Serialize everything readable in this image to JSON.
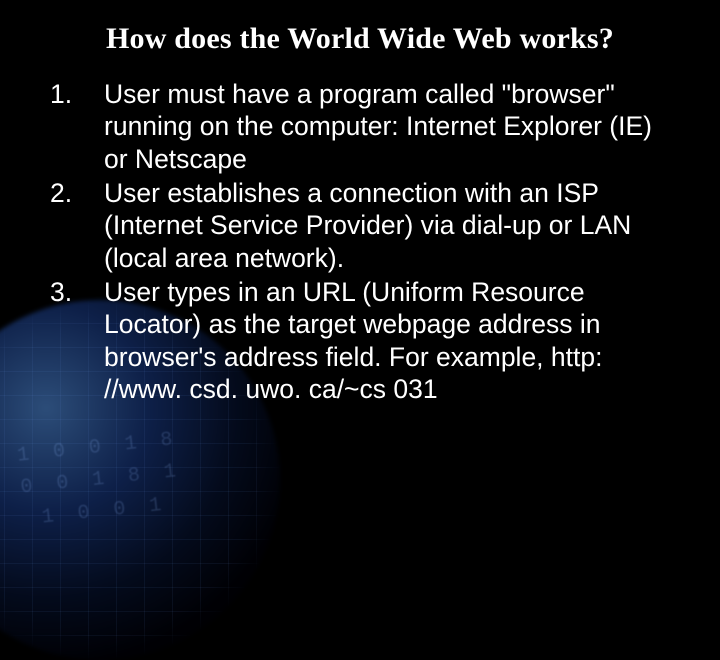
{
  "slide": {
    "title": "How does the World Wide Web works?",
    "items": [
      "User must have a program called \"browser\" running on the computer: Internet Explorer (IE) or Netscape",
      "User establishes a connection with an ISP (Internet Service Provider) via dial-up or LAN (local area network).",
      "User types in an URL (Uniform Resource Locator) as the target webpage address in browser's address field. For example, http: //www. csd. uwo. ca/~cs 031"
    ]
  }
}
